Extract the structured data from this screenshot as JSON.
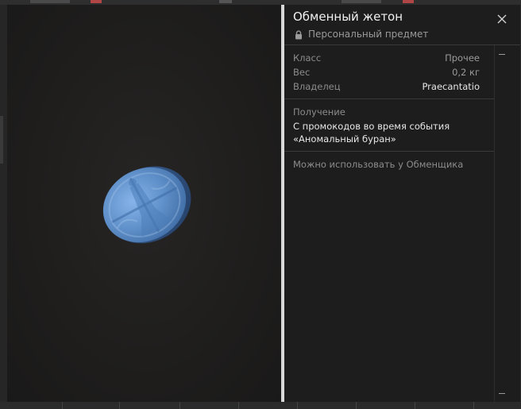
{
  "item": {
    "title": "Обменный жетон",
    "subtitle": "Персональный предмет",
    "stats": [
      {
        "key": "Класс",
        "value": "Прочее"
      },
      {
        "key": "Вес",
        "value": "0,2 кг"
      },
      {
        "key": "Владелец",
        "value": "Praecantatio"
      }
    ],
    "obtain": {
      "label": "Получение",
      "text": "С промокодов во время события «Аномальный буран»"
    },
    "usage": "Можно использовать у Обменщика"
  },
  "icons": {
    "lock": "lock-icon",
    "close": "close-icon",
    "token": "token-image"
  },
  "colors": {
    "accent": "#d9d9d9",
    "panel": "#1d1d1d",
    "token": "#6f9fd8"
  }
}
